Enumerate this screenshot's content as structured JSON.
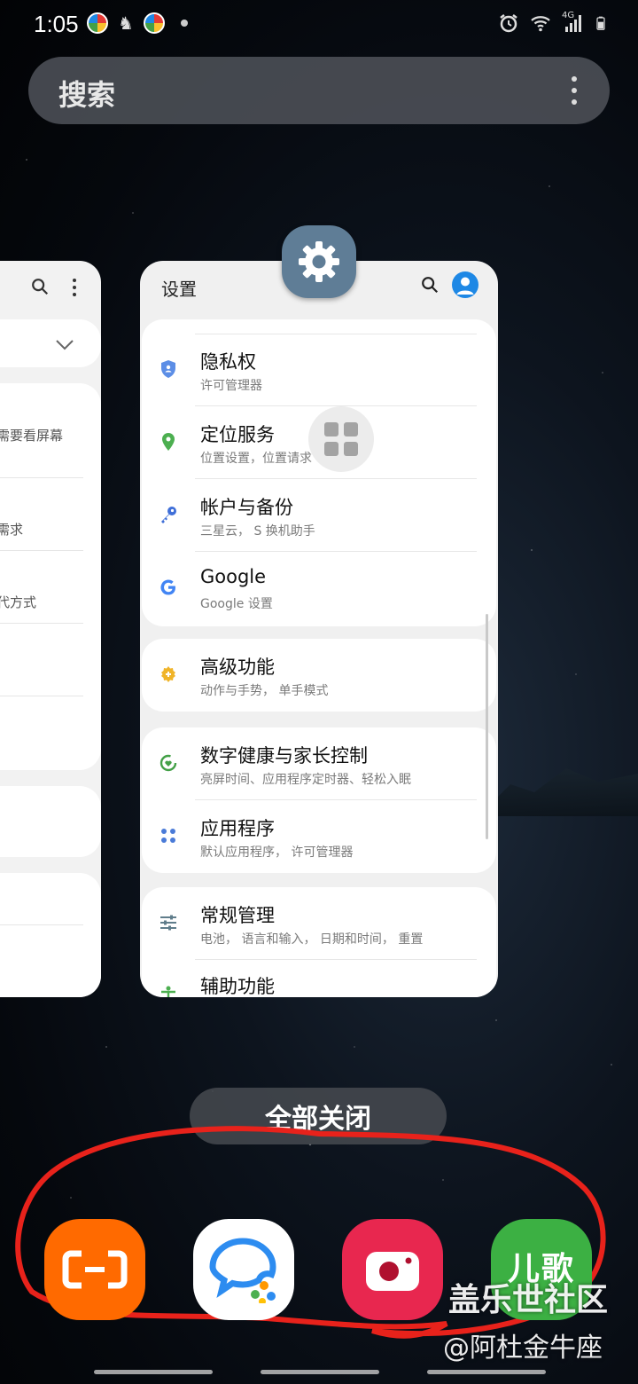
{
  "status_bar": {
    "time": "1:05",
    "icons": [
      "colorful-app-icon",
      "person-icon",
      "colorful-app-icon",
      "dot-icon",
      "alarm-icon",
      "wifi-icon",
      "signal-4g-icon",
      "battery-icon"
    ],
    "network_label": "4G"
  },
  "search": {
    "placeholder": "搜索"
  },
  "left_card": {
    "rows": [
      "需要看屏幕",
      "需求",
      "代方式"
    ]
  },
  "settings_card": {
    "title": "设置",
    "groups": [
      {
        "items": [
          {
            "title": "隐私权",
            "subtitle": "许可管理器",
            "icon": "shield-icon",
            "color": "#5c8ee6"
          },
          {
            "title": "定位服务",
            "subtitle": "位置设置，位置请求",
            "icon": "location-pin-icon",
            "color": "#4caf50"
          },
          {
            "title": "帐户与备份",
            "subtitle": "三星云， S 换机助手",
            "icon": "key-icon",
            "color": "#3f6fd8"
          },
          {
            "title": "Google",
            "subtitle": "Google 设置",
            "icon": "google-icon",
            "color": "#4285f4"
          }
        ]
      },
      {
        "items": [
          {
            "title": "高级功能",
            "subtitle": "动作与手势， 单手模式",
            "icon": "gear-plus-icon",
            "color": "#f0b429"
          }
        ]
      },
      {
        "items": [
          {
            "title": "数字健康与家长控制",
            "subtitle": "亮屏时间、应用程序定时器、轻松入眠",
            "icon": "wellbeing-icon",
            "color": "#43a047"
          },
          {
            "title": "应用程序",
            "subtitle": "默认应用程序， 许可管理器",
            "icon": "apps-grid-icon",
            "color": "#4a7bd8"
          }
        ]
      },
      {
        "items": [
          {
            "title": "常规管理",
            "subtitle": "电池， 语言和输入， 日期和时间， 重置",
            "icon": "sliders-icon",
            "color": "#607d8b"
          },
          {
            "title": "辅助功能",
            "subtitle": "",
            "icon": "accessibility-icon",
            "color": "#4caf50"
          }
        ]
      }
    ]
  },
  "close_all_label": "全部关闭",
  "dock": [
    {
      "name": "alibaba-cloud-app",
      "color": "#ff6a00"
    },
    {
      "name": "chat-app",
      "color": "#ffffff"
    },
    {
      "name": "camera-app",
      "color": "#e8274f"
    },
    {
      "name": "kids-songs-app",
      "color": "#3cb043",
      "label": "儿歌"
    }
  ],
  "watermark": {
    "line1": "盖乐世社区",
    "line2": "@阿杜金牛座"
  },
  "annotation_color": "#e8221b"
}
